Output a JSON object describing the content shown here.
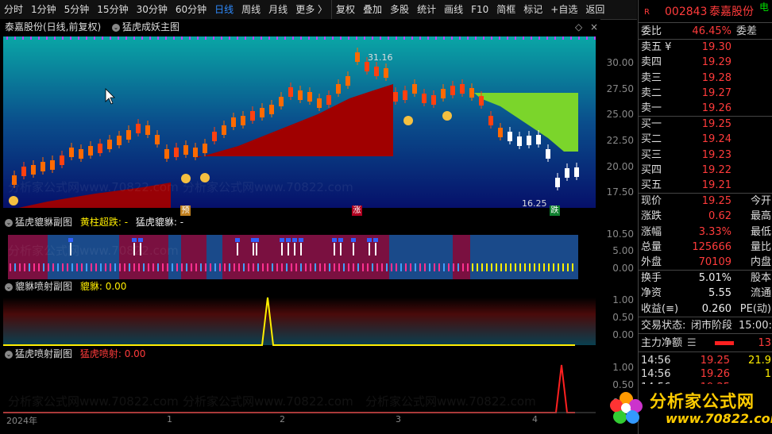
{
  "toolbar": {
    "items": [
      "分时",
      "1分钟",
      "5分钟",
      "15分钟",
      "30分钟",
      "60分钟",
      "日线",
      "周线",
      "月线",
      "更多 〉",
      "复权",
      "叠加",
      "多股",
      "统计",
      "画线",
      "F10",
      "简框",
      "标记",
      "+自选",
      "返回"
    ],
    "active": "日线"
  },
  "main_chart": {
    "title": "泰嘉股份(日线,前复权)",
    "indicator": "猛虎成妖主图",
    "high_label": "31.16",
    "low_label": "16.25",
    "markers": {
      "yu": "预",
      "zhang": "涨",
      "die": "跌"
    },
    "yaxis": [
      "30.00",
      "27.50",
      "25.00",
      "22.50",
      "20.00",
      "17.50"
    ]
  },
  "sub1": {
    "title": "猛虎貔貅副图",
    "legend_a": "黄柱超跌: -",
    "legend_b": "猛虎貔貅: -",
    "yaxis": [
      "10.50",
      "5.00",
      "0.00"
    ]
  },
  "sub2": {
    "title": "貔貅喷射副图",
    "legend": "貔貅: 0.00",
    "yaxis": [
      "1.00",
      "0.50",
      "0.00"
    ]
  },
  "sub3": {
    "title": "猛虎喷射副图",
    "legend": "猛虎喷射: 0.00",
    "yaxis": [
      "1.00",
      "0.50",
      "0.00"
    ]
  },
  "xaxis": [
    "2024年",
    "1",
    "2",
    "3",
    "4"
  ],
  "watermark": "分析家公式网www.70822.com",
  "quote": {
    "code": "002843",
    "name": "泰嘉股份",
    "r_badge": "R",
    "dian": "电",
    "weibi_label": "委比",
    "weibi": "46.45%",
    "weicha_label": "委差",
    "asks": [
      {
        "label": "卖五 ¥",
        "price": "19.30"
      },
      {
        "label": "卖四",
        "price": "19.29"
      },
      {
        "label": "卖三",
        "price": "19.28"
      },
      {
        "label": "卖二",
        "price": "19.27"
      },
      {
        "label": "卖一",
        "price": "19.26"
      }
    ],
    "bids": [
      {
        "label": "买一",
        "price": "19.25"
      },
      {
        "label": "买二",
        "price": "19.24"
      },
      {
        "label": "买三",
        "price": "19.23"
      },
      {
        "label": "买四",
        "price": "19.22"
      },
      {
        "label": "买五",
        "price": "19.21"
      }
    ],
    "stats": [
      {
        "label": "现价",
        "value": "19.25",
        "label2": "今开"
      },
      {
        "label": "涨跌",
        "value": "0.62",
        "label2": "最高"
      },
      {
        "label": "涨幅",
        "value": "3.33%",
        "label2": "最低"
      },
      {
        "label": "总量",
        "value": "125666",
        "label2": "量比"
      },
      {
        "label": "外盘",
        "value": "70109",
        "label2": "内盘"
      }
    ],
    "stats2": [
      {
        "label": "换手",
        "value": "5.01%",
        "label2": "股本"
      },
      {
        "label": "净资",
        "value": "5.55",
        "label2": "流通"
      },
      {
        "label": "收益(≡)",
        "value": "0.260",
        "label2": "PE(动)"
      }
    ],
    "trade_status_label": "交易状态:",
    "trade_status": "闭市阶段",
    "trade_time": "15:00:",
    "main_flow_label": "主力净额",
    "main_flow_value": "13",
    "ticks": [
      {
        "time": "14:56",
        "price": "19.25",
        "vol": "21.9"
      },
      {
        "time": "14:56",
        "price": "19.26",
        "vol": "1"
      },
      {
        "time": "14:56",
        "price": "19.25",
        "vol": ""
      }
    ],
    "logo_text": "分析家公式网",
    "logo_url": "www.70822.com"
  },
  "colors": {
    "up": "#ff3b3b",
    "down": "#00e000",
    "accent": "#2f8cff"
  }
}
